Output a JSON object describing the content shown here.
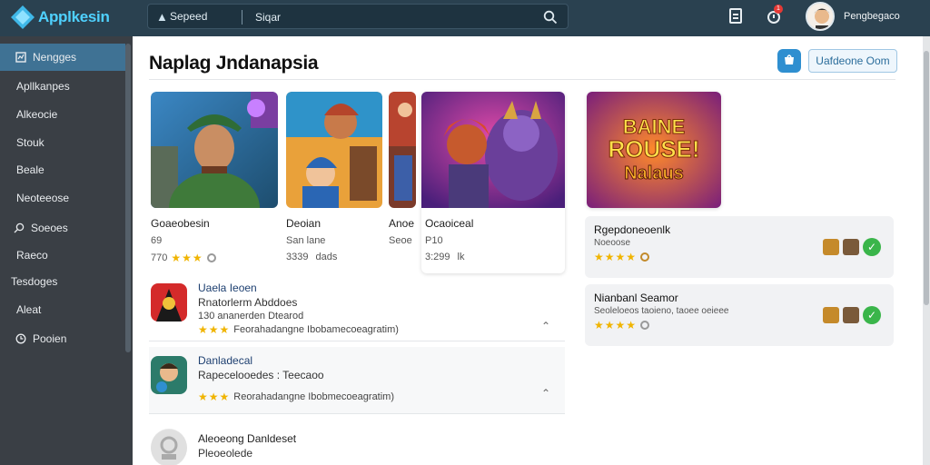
{
  "app": {
    "name": "Applkesin"
  },
  "search": {
    "scope": "Sepeed",
    "placeholder": "Siqar"
  },
  "user": {
    "name": "Pengbegaco"
  },
  "notifications": {
    "count": "1"
  },
  "sidebar": {
    "items": [
      {
        "label": "Nengges",
        "icon": "dashboard-icon",
        "active": true
      },
      {
        "label": "Apllkanpes",
        "icon": ""
      },
      {
        "label": "Alkeocie",
        "icon": ""
      },
      {
        "label": "Stouk",
        "icon": ""
      },
      {
        "label": "Beale",
        "icon": ""
      },
      {
        "label": "Neoteeose",
        "icon": ""
      },
      {
        "label": "Soeoes",
        "icon": "search-icon"
      },
      {
        "label": "Raeco",
        "icon": ""
      },
      {
        "label": "Tesdoges",
        "icon": ""
      },
      {
        "label": "Aleat",
        "icon": ""
      },
      {
        "label": "Pooien",
        "icon": "clock-icon"
      }
    ]
  },
  "main": {
    "title": "Naplag Jndanapsia",
    "header_button": "Uafdeone Oom"
  },
  "featured": [
    {
      "title": "Goaeobesin",
      "sub": "69",
      "price": "770",
      "rating": 3
    },
    {
      "title": "Deoian",
      "sub": "San lane",
      "price": "3339",
      "extra": "dads",
      "rating": 0
    },
    {
      "title": "Anoe",
      "sub": "Seoe",
      "price": "",
      "rating": 0
    },
    {
      "title": "Ocaoiceal",
      "sub": "P10",
      "price": "3:299",
      "extra": "lk",
      "rating": 0
    },
    {
      "banner_line1": "BAINE",
      "banner_line2": "ROUSE!",
      "banner_line3": "Nalaus"
    }
  ],
  "list": [
    {
      "title": "Uaela Ieoen",
      "sub": "Rnatorlerm Abddoes",
      "meta": "130 ananerden Dtearod",
      "rating": 3,
      "rating_text": "Feorahadangne Ibobamecoeagratim)"
    },
    {
      "title": "Danladecal",
      "sub": "Rapecelooedes : Teecaoo",
      "meta": "",
      "rating": 3,
      "rating_text": "Reorahadangne Ibobmecoeagratim)"
    },
    {
      "title": "Aleoeong Danldeset",
      "sub": "Pleoeolede",
      "meta": "",
      "rating": 0,
      "rating_text": ""
    }
  ],
  "right_list": [
    {
      "title": "Rgepdoneoenlk",
      "sub": "Noeoose",
      "rating": 4
    },
    {
      "title": "Nianbanl Seamor",
      "sub": "Seoleloeos taoieno, taoee oeieee",
      "rating": 4
    }
  ],
  "colors": {
    "topbar": "#2a4150",
    "sidebar": "#3a3f45",
    "sidebar_active": "#3f7294",
    "accent": "#2f8fd0",
    "star": "#f0b400",
    "check": "#3ab54a"
  }
}
